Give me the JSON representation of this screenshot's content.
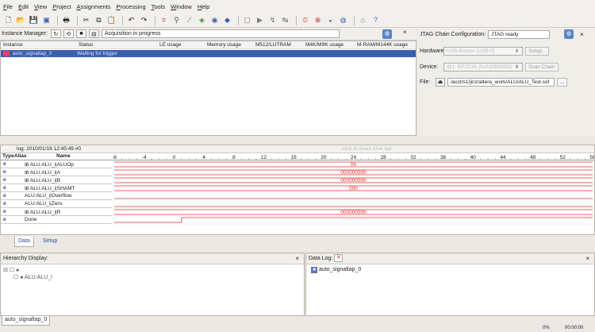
{
  "menu": [
    "File",
    "Edit",
    "View",
    "Project",
    "Assignments",
    "Processing",
    "Tools",
    "Window",
    "Help"
  ],
  "instance_manager": {
    "label": "Instance Manager:",
    "status": "Acquisition in progress",
    "columns": [
      "Instance",
      "Status",
      "LE usage",
      "Memory usage",
      "M512/LUTRAM",
      "M4K/M9K usage",
      "M-RAM/M144K usage"
    ],
    "rows": [
      {
        "instance": "auto_signaltap_0",
        "status": "Waiting for trigger"
      }
    ]
  },
  "jtag": {
    "label": "JTAG Chain Configuration:",
    "status": "JTAG ready",
    "hardware_label": "Hardware:",
    "hardware_value": "USB-Blaster [USB-0]",
    "setup_button": "Setup...",
    "device_label": "Device:",
    "device_value": "@1: EP2C35 (0x020B40DD)",
    "scan_button": "Scan Chain",
    "file_label": "File:",
    "file_value": "/acct/s1/jinz/altera_work/ALU/ALU_Test.sof",
    "browse_button": "..."
  },
  "waveform": {
    "log_label": "log: 2010/01/16 12:45:49  #0",
    "hint": "click to insert time bar",
    "col_type": "Type",
    "col_alias": "Alias",
    "col_name": "Name",
    "ticks": [
      "-8",
      "-4",
      "0",
      "4",
      "8",
      "12",
      "16",
      "20",
      "24",
      "28",
      "32",
      "36",
      "40",
      "44",
      "48",
      "52",
      "56"
    ],
    "signals": [
      {
        "name": "⊞ ALU:ALU_i|ALUOp",
        "value": "0h",
        "kind": "bus"
      },
      {
        "name": "⊞ ALU:ALU_i|A",
        "value": "00000000h",
        "kind": "bus"
      },
      {
        "name": "⊞ ALU:ALU_i|B",
        "value": "00000000h",
        "kind": "bus"
      },
      {
        "name": "⊞ ALU:ALU_i|SHAMT",
        "value": "00h",
        "kind": "bus"
      },
      {
        "name": "ALU:ALU_i|Overflow",
        "value": "",
        "kind": "low"
      },
      {
        "name": "ALU:ALU_i|Zero",
        "value": "",
        "kind": "low"
      },
      {
        "name": "⊞ ALU:ALU_i|R",
        "value": "00000000h",
        "kind": "bus"
      },
      {
        "name": "Done",
        "value": "",
        "kind": "step"
      }
    ]
  },
  "tabs": [
    "Data",
    "Setup"
  ],
  "hierarchy": {
    "label": "Hierarchy Display:",
    "items": [
      "ALU:ALU_i"
    ]
  },
  "data_log": {
    "label": "Data Log:",
    "items": [
      "auto_signaltap_0"
    ]
  },
  "bottom_tab": "auto_signaltap_0",
  "status_bar": {
    "percent": "0%",
    "time": "00:00:00"
  },
  "colors": {
    "wave": "#e03030",
    "selection": "#3a5fb0"
  }
}
